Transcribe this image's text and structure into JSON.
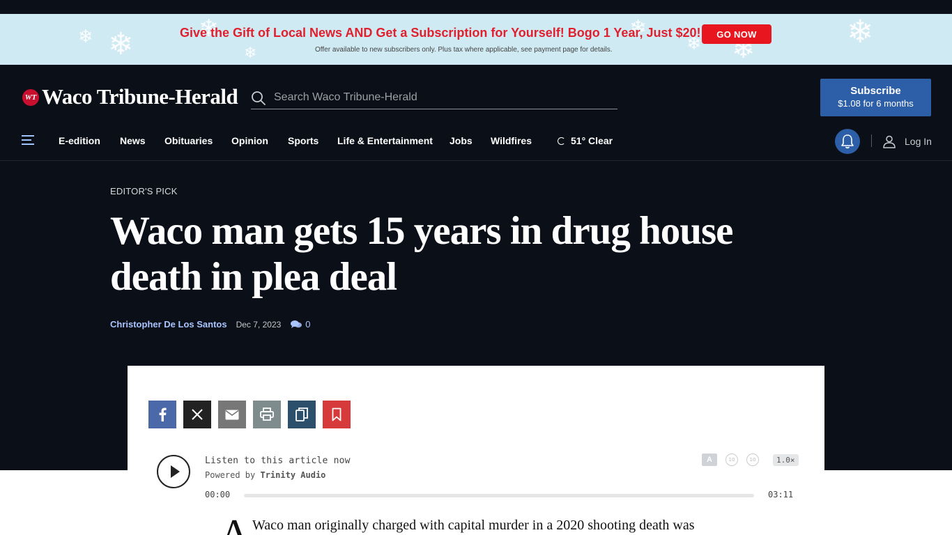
{
  "promo": {
    "headline": "Give the Gift of Local News AND Get a Subscription for Yourself! Bogo 1 Year, Just $20!",
    "subtext": "Offer available to new subscribers only. Plus tax where applicable, see payment page for details.",
    "cta": "GO NOW",
    "colors": {
      "background": "#cfeaf2",
      "headline": "#e0202e",
      "cta_bg": "#e8161f"
    }
  },
  "header": {
    "logo_mark": "WT",
    "logo_text": "Waco Tribune-Herald",
    "search_placeholder": "Search Waco Tribune-Herald",
    "subscribe_label": "Subscribe",
    "subscribe_price": "$1.08 for 6 months",
    "colors": {
      "background": "#0b0f17",
      "accent": "#2d5fa8"
    }
  },
  "nav": {
    "items": [
      "E-edition",
      "News",
      "Obituaries",
      "Opinion",
      "Sports",
      "Life & Entertainment",
      "Jobs",
      "Wildfires"
    ],
    "weather": "51° Clear",
    "login": "Log In",
    "icons": [
      "menu-icon",
      "moon-icon",
      "bell-icon",
      "user-icon"
    ]
  },
  "article": {
    "kicker": "EDITOR'S PICK",
    "title": "Waco man gets 15 years in drug house death in plea deal",
    "author": "Christopher De Los Santos",
    "date": "Dec 7, 2023",
    "comment_count": "0",
    "dropcap": "A",
    "first_line": "Waco man originally charged with capital murder in a 2020 shooting death was"
  },
  "share": {
    "buttons": [
      {
        "name": "facebook",
        "icon": "facebook-icon",
        "color": "#4b69a8"
      },
      {
        "name": "x",
        "icon": "x-icon",
        "color": "#222222"
      },
      {
        "name": "email",
        "icon": "email-icon",
        "color": "#777777"
      },
      {
        "name": "print",
        "icon": "print-icon",
        "color": "#7f8c8d"
      },
      {
        "name": "copy",
        "icon": "copy-icon",
        "color": "#2c4f6b"
      },
      {
        "name": "save",
        "icon": "bookmark-icon",
        "color": "#d63a3a"
      }
    ]
  },
  "audio": {
    "listen_label": "Listen to this article now",
    "powered_prefix": "Powered by",
    "powered_brand": "Trinity Audio",
    "time_current": "00:00",
    "time_total": "03:11",
    "speed": "1.0×",
    "progress": 0,
    "translate_icon": "translate-icon",
    "skip_back_label": "10",
    "skip_forward_label": "10"
  }
}
